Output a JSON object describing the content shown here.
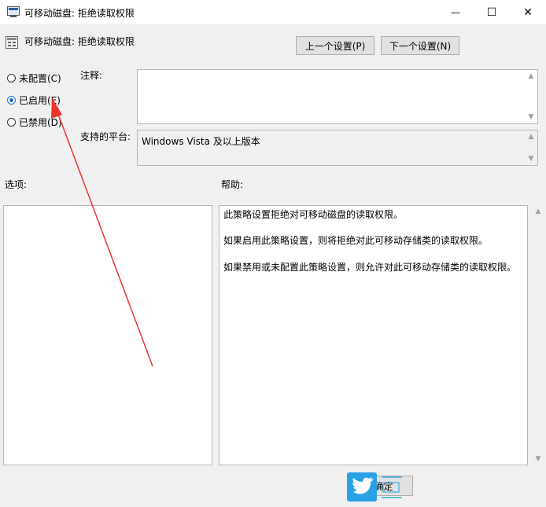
{
  "window": {
    "title": "可移动磁盘: 拒绝读取权限",
    "minimize_glyph": "—",
    "maximize_glyph": "☐",
    "close_glyph": "✕"
  },
  "header": {
    "policy_name": "可移动磁盘: 拒绝读取权限",
    "prev_button": "上一个设置(P)",
    "next_button": "下一个设置(N)"
  },
  "state": {
    "options": [
      {
        "label": "未配置(C)",
        "checked": false
      },
      {
        "label": "已启用(E)",
        "checked": true
      },
      {
        "label": "已禁用(D)",
        "checked": false
      }
    ]
  },
  "comment": {
    "label": "注释:",
    "value": ""
  },
  "platform": {
    "label": "支持的平台:",
    "value": "Windows Vista 及以上版本"
  },
  "options_pane": {
    "label": "选项:"
  },
  "help_pane": {
    "label": "帮助:",
    "paragraphs": [
      "此策略设置拒绝对可移动磁盘的读取权限。",
      "如果启用此策略设置，则将拒绝对此可移动存储类的读取权限。",
      "如果禁用或未配置此策略设置，则允许对此可移动存储类的读取权限。"
    ]
  },
  "footer": {
    "ok_button": "确定"
  },
  "colors": {
    "annotation_arrow": "#e8352c",
    "watermark_blue": "#2aa0e6"
  }
}
